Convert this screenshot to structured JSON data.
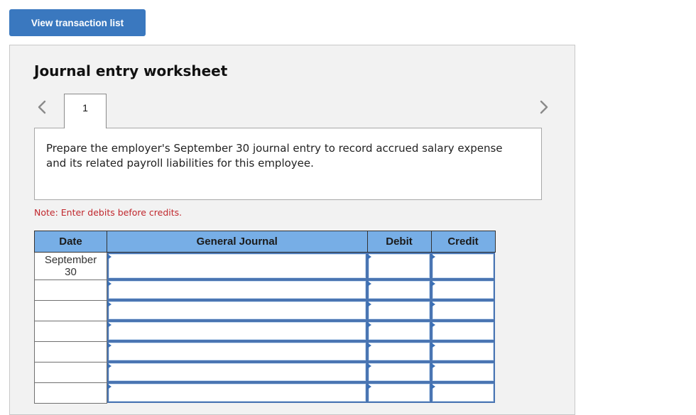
{
  "toolbar": {
    "view_transactions_label": "View transaction list"
  },
  "worksheet": {
    "title": "Journal entry worksheet",
    "nav": {
      "prev_icon": "chevron-left-icon",
      "next_icon": "chevron-right-icon"
    },
    "tabs": [
      {
        "label": "1",
        "active": true
      }
    ],
    "prompt": "Prepare the employer's September 30 journal entry to record accrued salary expense and its related payroll liabilities for this employee.",
    "note": "Note: Enter debits before credits.",
    "colors": {
      "header_bg": "#77aee6",
      "button_bg": "#3a78bf",
      "note_text": "#c0272d",
      "input_border": "#4a75b2"
    },
    "table": {
      "headers": [
        "Date",
        "General Journal",
        "Debit",
        "Credit"
      ],
      "rows": [
        {
          "date": "September\n30",
          "account": "",
          "debit": "",
          "credit": ""
        },
        {
          "date": "",
          "account": "",
          "debit": "",
          "credit": ""
        },
        {
          "date": "",
          "account": "",
          "debit": "",
          "credit": ""
        },
        {
          "date": "",
          "account": "",
          "debit": "",
          "credit": ""
        },
        {
          "date": "",
          "account": "",
          "debit": "",
          "credit": ""
        },
        {
          "date": "",
          "account": "",
          "debit": "",
          "credit": ""
        },
        {
          "date": "",
          "account": "",
          "debit": "",
          "credit": ""
        }
      ]
    }
  }
}
